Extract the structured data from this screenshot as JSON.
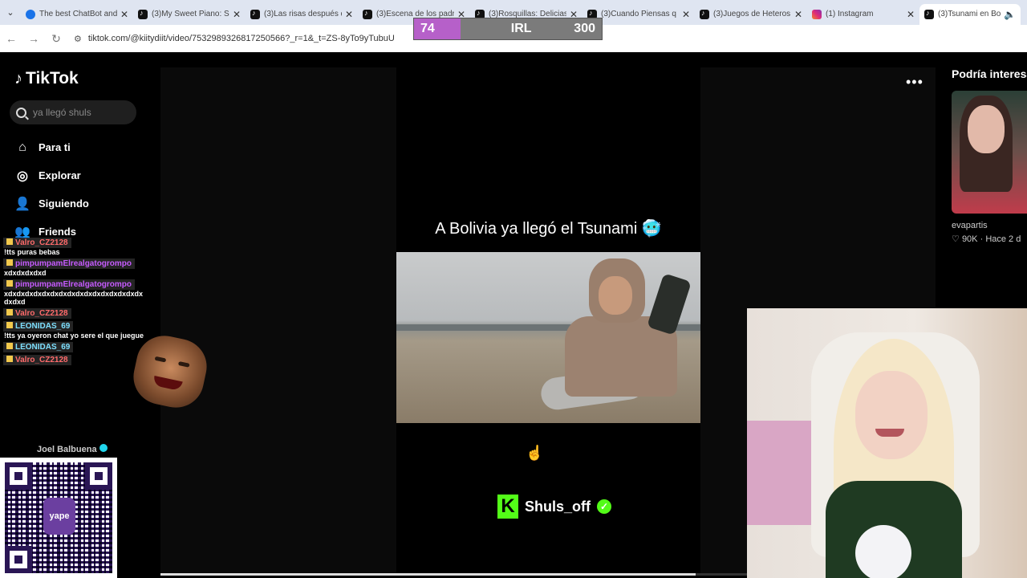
{
  "browser": {
    "tabs": [
      {
        "title": "The best ChatBot and",
        "icon": "chatbot-favicon"
      },
      {
        "title": "(3)My Sweet Piano: S",
        "icon": "tiktok-favicon"
      },
      {
        "title": "(3)Las risas después d",
        "icon": "tiktok-favicon"
      },
      {
        "title": "(3)Escena de los padr",
        "icon": "tiktok-favicon"
      },
      {
        "title": "(3)Rosquillas: Delicias",
        "icon": "tiktok-favicon"
      },
      {
        "title": "(3)Cuando Piensas q",
        "icon": "tiktok-favicon"
      },
      {
        "title": "(3)Juegos de Heteros",
        "icon": "tiktok-favicon"
      },
      {
        "title": "(1) Instagram",
        "icon": "instagram-favicon"
      },
      {
        "title": "(3)Tsunami en Bo",
        "icon": "tiktok-favicon"
      }
    ],
    "url": "tiktok.com/@kiitydiit/video/7532989326817250566?_r=1&_t=ZS-8yTo9yTubuU"
  },
  "goal": {
    "current": "74",
    "label": "IRL",
    "target": "300",
    "fraction": 0.2467,
    "fill_color": "#b660c9"
  },
  "tiktok": {
    "logo": "TikTok",
    "search_placeholder": "ya llegó shuls",
    "nav": [
      {
        "label": "Para ti",
        "icon": "home-icon"
      },
      {
        "label": "Explorar",
        "icon": "compass-icon"
      },
      {
        "label": "Siguiendo",
        "icon": "following-icon"
      },
      {
        "label": "Friends",
        "icon": "friends-icon"
      }
    ],
    "sidebar_following_user": "Joel Balbuena",
    "video": {
      "caption": "A Bolivia ya llegó el Tsunami 🥶",
      "handle": "Shuls_off",
      "progress": 0.69
    },
    "recommendations": {
      "title": "Podría interesarte",
      "items": [
        {
          "user": "evapartis",
          "likes": "90K",
          "time": "Hace 2 d"
        }
      ]
    }
  },
  "chat": [
    {
      "user": "Valro_CZ2128",
      "message": "!tts puras bebas",
      "color": "#ff6b6b"
    },
    {
      "user": "pimpumpamElrealgatogrompo",
      "message": "xdxdxdxdxd",
      "color": "#c65bff"
    },
    {
      "user": "pimpumpamElrealgatogrompo",
      "message": "xdxdxdxdxdxdxdxdxdxdxdxdxdxdxdxdxdxdxd",
      "color": "#c65bff"
    },
    {
      "user": "Valro_CZ2128",
      "message": "",
      "color": "#ff6b6b"
    },
    {
      "user": "LEONIDAS_69",
      "message": "!tts ya oyeron chat yo sere el que juegue",
      "color": "#7ee0ff"
    },
    {
      "user": "LEONIDAS_69",
      "message": "",
      "color": "#7ee0ff"
    },
    {
      "user": "Valro_CZ2128",
      "message": "",
      "color": "#ff6b6b"
    }
  ],
  "qr": {
    "brand": "yape"
  }
}
